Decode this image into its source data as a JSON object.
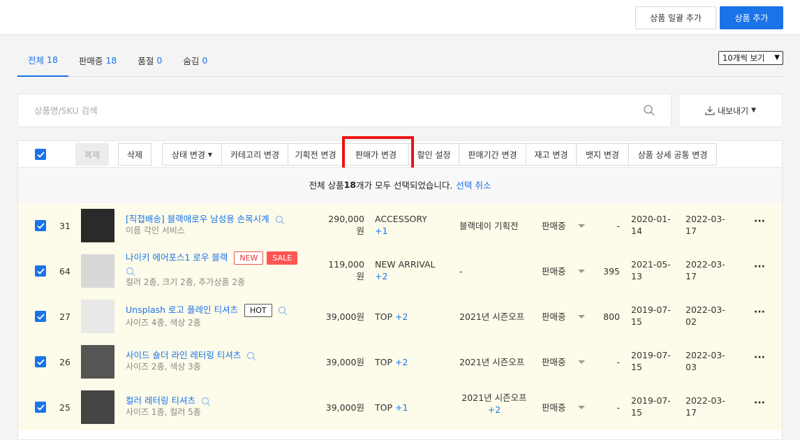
{
  "header": {
    "bulk_add_label": "상품 일괄 추가",
    "add_label": "상품 추가"
  },
  "tabs": [
    {
      "label": "전체",
      "count": "18"
    },
    {
      "label": "판매중",
      "count": "18"
    },
    {
      "label": "품절",
      "count": "0"
    },
    {
      "label": "숨김",
      "count": "0"
    }
  ],
  "perpage": {
    "selected": "10개씩 보기"
  },
  "search": {
    "placeholder": "상품명/SKU 검색"
  },
  "export_label": "내보내기",
  "toolbar": {
    "copy": "복제",
    "delete": "삭제",
    "status_change": "상태 변경",
    "category_change": "카테고리 변경",
    "plan_change": "기획전 변경",
    "price_change": "판매가 변경",
    "discount": "할인 설정",
    "period_change": "판매기간 변경",
    "stock_change": "재고 변경",
    "badge_change": "뱃지 변경",
    "detail_change": "상품 상세 공통 변경"
  },
  "selection": {
    "prefix": "전체 상품 ",
    "count": "18",
    "suffix": "개가 모두 선택되었습니다.",
    "cancel": "선택 취소"
  },
  "rows": [
    {
      "id": "31",
      "name": "[직접배송] 블랙애로우 남성용 손목시계",
      "badges": [],
      "sub": "이름 각인 서비스",
      "price1": "290,000",
      "price2": "원",
      "category": "ACCESSORY",
      "cat_plus": "+1",
      "plan": "블랙데이 기획전",
      "plan_plus": "",
      "status": "판매중",
      "stock": "-",
      "date1a": "2020-01-",
      "date1b": "14",
      "date2a": "2022-03-",
      "date2b": "17"
    },
    {
      "id": "64",
      "name": "나이키 에어포스1 로우 블랙",
      "badges": [
        "NEW",
        "SALE"
      ],
      "sub": "컬러 2종, 크기 2종, 추가상품 2종",
      "price1": "119,000",
      "price2": "원",
      "category": "NEW ARRIVAL",
      "cat_plus": "+2",
      "plan": "-",
      "plan_plus": "",
      "status": "판매중",
      "stock": "395",
      "date1a": "2021-05-",
      "date1b": "13",
      "date2a": "2022-03-",
      "date2b": "17"
    },
    {
      "id": "27",
      "name": "Unsplash 로고 플레인 티셔츠",
      "badges": [
        "HOT"
      ],
      "sub": "사이즈 4종, 색상 2종",
      "price1": "39,000원",
      "price2": "",
      "category": "TOP",
      "cat_plus": "+2",
      "plan": "2021년 시즌오프",
      "plan_plus": "",
      "status": "판매중",
      "stock": "800",
      "date1a": "2019-07-",
      "date1b": "15",
      "date2a": "2022-03-",
      "date2b": "02"
    },
    {
      "id": "26",
      "name": "사이드 숄더 라인 레터링 티셔츠",
      "badges": [],
      "sub": "사이즈 2종, 색상 3종",
      "price1": "39,000원",
      "price2": "",
      "category": "TOP",
      "cat_plus": "+2",
      "plan": "2021년 시즌오프",
      "plan_plus": "",
      "status": "판매중",
      "stock": "-",
      "date1a": "2019-07-",
      "date1b": "15",
      "date2a": "2022-03-",
      "date2b": "03"
    },
    {
      "id": "25",
      "name": "컬러 레터링 티셔츠",
      "badges": [],
      "sub": "사이즈 1종, 컬러 5종",
      "price1": "39,000원",
      "price2": "",
      "category": "TOP",
      "cat_plus": "+1",
      "plan": "2021년 시즌오프",
      "plan_plus": "+2",
      "status": "판매중",
      "stock": "-",
      "date1a": "2019-07-",
      "date1b": "15",
      "date2a": "2022-03-",
      "date2b": "17"
    }
  ]
}
